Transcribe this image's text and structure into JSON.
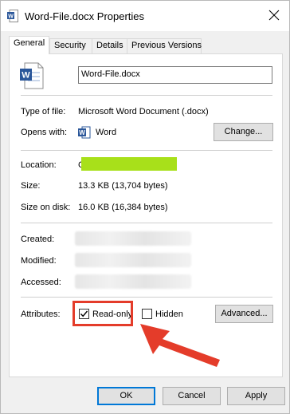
{
  "window": {
    "title": "Word-File.docx Properties"
  },
  "tabs": [
    {
      "label": "General"
    },
    {
      "label": "Security"
    },
    {
      "label": "Details"
    },
    {
      "label": "Previous Versions"
    }
  ],
  "general": {
    "filename": "Word-File.docx",
    "type_label": "Type of file:",
    "type_value": "Microsoft Word Document (.docx)",
    "opens_label": "Opens with:",
    "opens_value": "Word",
    "change_button": "Change...",
    "location_label": "Location:",
    "location_prefix": "C",
    "size_label": "Size:",
    "size_value": "13.3 KB (13,704 bytes)",
    "sizeondisk_label": "Size on disk:",
    "sizeondisk_value": "16.0 KB (16,384 bytes)",
    "created_label": "Created:",
    "modified_label": "Modified:",
    "accessed_label": "Accessed:",
    "attributes_label": "Attributes:",
    "readonly_label": "Read-only",
    "readonly_checked": true,
    "hidden_label": "Hidden",
    "hidden_checked": false,
    "advanced_button": "Advanced..."
  },
  "footer": {
    "ok": "OK",
    "cancel": "Cancel",
    "apply": "Apply"
  },
  "colors": {
    "word_blue": "#2b579a",
    "highlight_red": "#e43c2a",
    "redaction_green": "#a8e01a"
  }
}
